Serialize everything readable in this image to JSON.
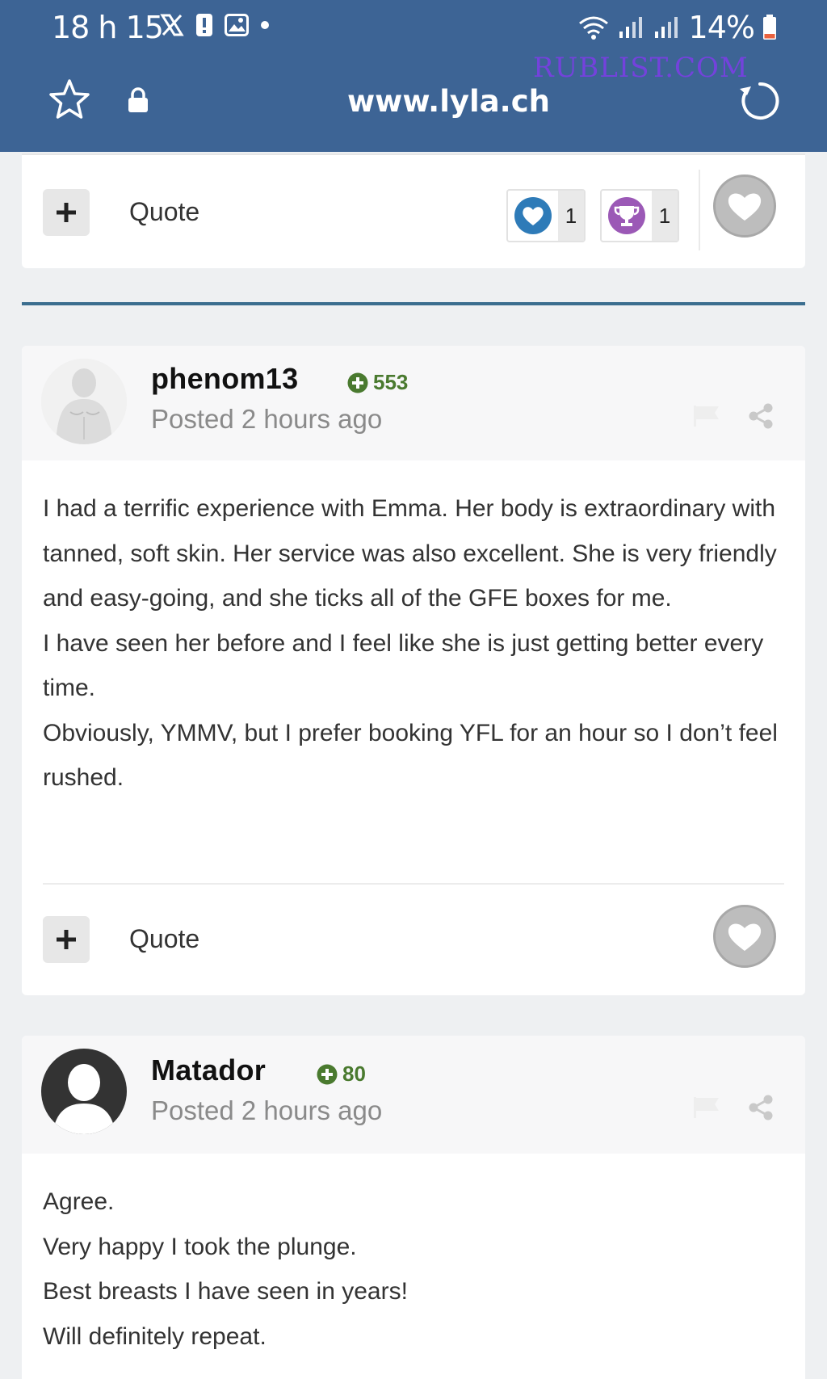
{
  "status_bar": {
    "time": "18 h 15",
    "battery": "14%"
  },
  "browser": {
    "url": "www.lyla.ch",
    "watermark": "RUBLIST.COM"
  },
  "previous_post_footer": {
    "quote_label": "Quote",
    "reactions": [
      {
        "icon": "heart-reaction-icon",
        "count": "1",
        "color": "#2e7bb8"
      },
      {
        "icon": "trophy-reaction-icon",
        "count": "1",
        "color": "#9b59b6"
      }
    ]
  },
  "posts": [
    {
      "author": "phenom13",
      "reputation": "553",
      "posted": "Posted 2 hours ago",
      "body": [
        "I had a terrific experience with Emma. Her body is extraordinary with tanned, soft skin. Her service was also excellent. She is very friendly and easy-going, and she ticks all of the GFE boxes for me.",
        "I have seen her before and I feel like she is just getting better every time.",
        "Obviously, YMMV, but I prefer booking YFL for an hour so I don’t feel rushed."
      ],
      "quote_label": "Quote"
    },
    {
      "author": "Matador",
      "reputation": "80",
      "posted": "Posted 2 hours ago",
      "body": [
        "Agree.",
        "Very happy I took the plunge.",
        "Best breasts I have seen in years!",
        "Will definitely repeat."
      ]
    }
  ],
  "colors": {
    "chrome": "#3d6495",
    "reputation": "#4a7a2f",
    "divider": "#3b6e8f"
  }
}
